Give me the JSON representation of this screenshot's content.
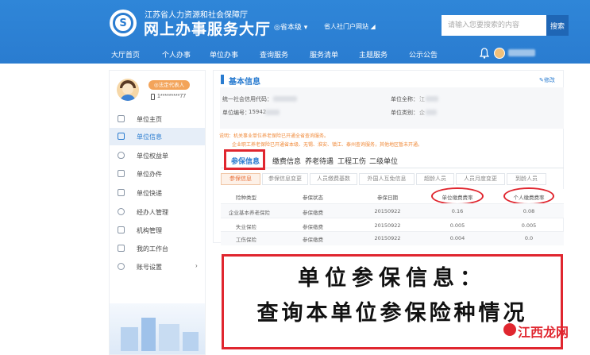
{
  "header": {
    "org_name": "江苏省人力资源和社会保障厅",
    "hall_title": "网上办事服务大厅",
    "region": "◎省本级 ▾",
    "portal": "省人社门户网站 ◢",
    "search_placeholder": "请输入您要搜索的内容",
    "search_button": "搜索",
    "nav": [
      "大厅首页",
      "个人办事",
      "单位办事",
      "查询服务",
      "服务清单",
      "主题服务",
      "公示公告"
    ]
  },
  "sidebar": {
    "badge": "◎法定代表人",
    "phone": "1*********77",
    "items": [
      {
        "label": "单位主页",
        "icon": "home-icon",
        "active": false
      },
      {
        "label": "单位信息",
        "icon": "document-icon",
        "active": true
      },
      {
        "label": "单位权益单",
        "icon": "shield-icon",
        "active": false
      },
      {
        "label": "单位办件",
        "icon": "file-icon",
        "active": false
      },
      {
        "label": "单位快递",
        "icon": "truck-icon",
        "active": false
      },
      {
        "label": "经办人管理",
        "icon": "person-icon",
        "active": false
      },
      {
        "label": "机构管理",
        "icon": "building-icon",
        "active": false
      },
      {
        "label": "我的工作台",
        "icon": "desk-icon",
        "active": false
      },
      {
        "label": "账号设置",
        "icon": "gear-icon",
        "active": false,
        "arrow": "›"
      }
    ]
  },
  "info": {
    "title": "基本信息",
    "edit": "✎修改",
    "credit_code_label": "统一社会信用代码：",
    "unit_code_label": "单位编号：",
    "unit_code_value": "15942",
    "full_name_label": "单位全称：",
    "full_name_value": "江",
    "unit_type_label": "单位类别：",
    "unit_type_value": "企",
    "notice_1": "说明：机关事业单位养老保险已开通全省查询服务。",
    "notice_2": "企业职工养老保险已开通省本级、无锡、淮安、镇江、泰州查询服务，其他地区暂未开通。"
  },
  "tabs": [
    "参保信息",
    "缴费信息",
    "养老待遇",
    "工程工伤",
    "二级单位"
  ],
  "subtabs": [
    "参保信息",
    "参保信息变更",
    "人员缴费基数",
    "外国人互免信息",
    "超龄人员",
    "人员月度变更",
    "到龄人员"
  ],
  "table": {
    "headers": [
      "险种类型",
      "参保状态",
      "参保日期",
      "单位缴费费率",
      "个人缴费费率"
    ],
    "rows": [
      [
        "企业基本养老保险",
        "参保缴费",
        "20150922",
        "0.16",
        "0.08"
      ],
      [
        "失业保险",
        "参保缴费",
        "20150922",
        "0.005",
        "0.005"
      ],
      [
        "工伤保险",
        "参保缴费",
        "20150922",
        "0.004",
        "0.0"
      ]
    ]
  },
  "annotation": {
    "line1": "单位参保信息：",
    "line2": "查询本单位参保险种情况"
  },
  "watermark": "江西龙网",
  "colors": {
    "header_blue": "#2a7cd0",
    "highlight_red": "#e0262f",
    "notice_orange": "#f08a3a"
  }
}
